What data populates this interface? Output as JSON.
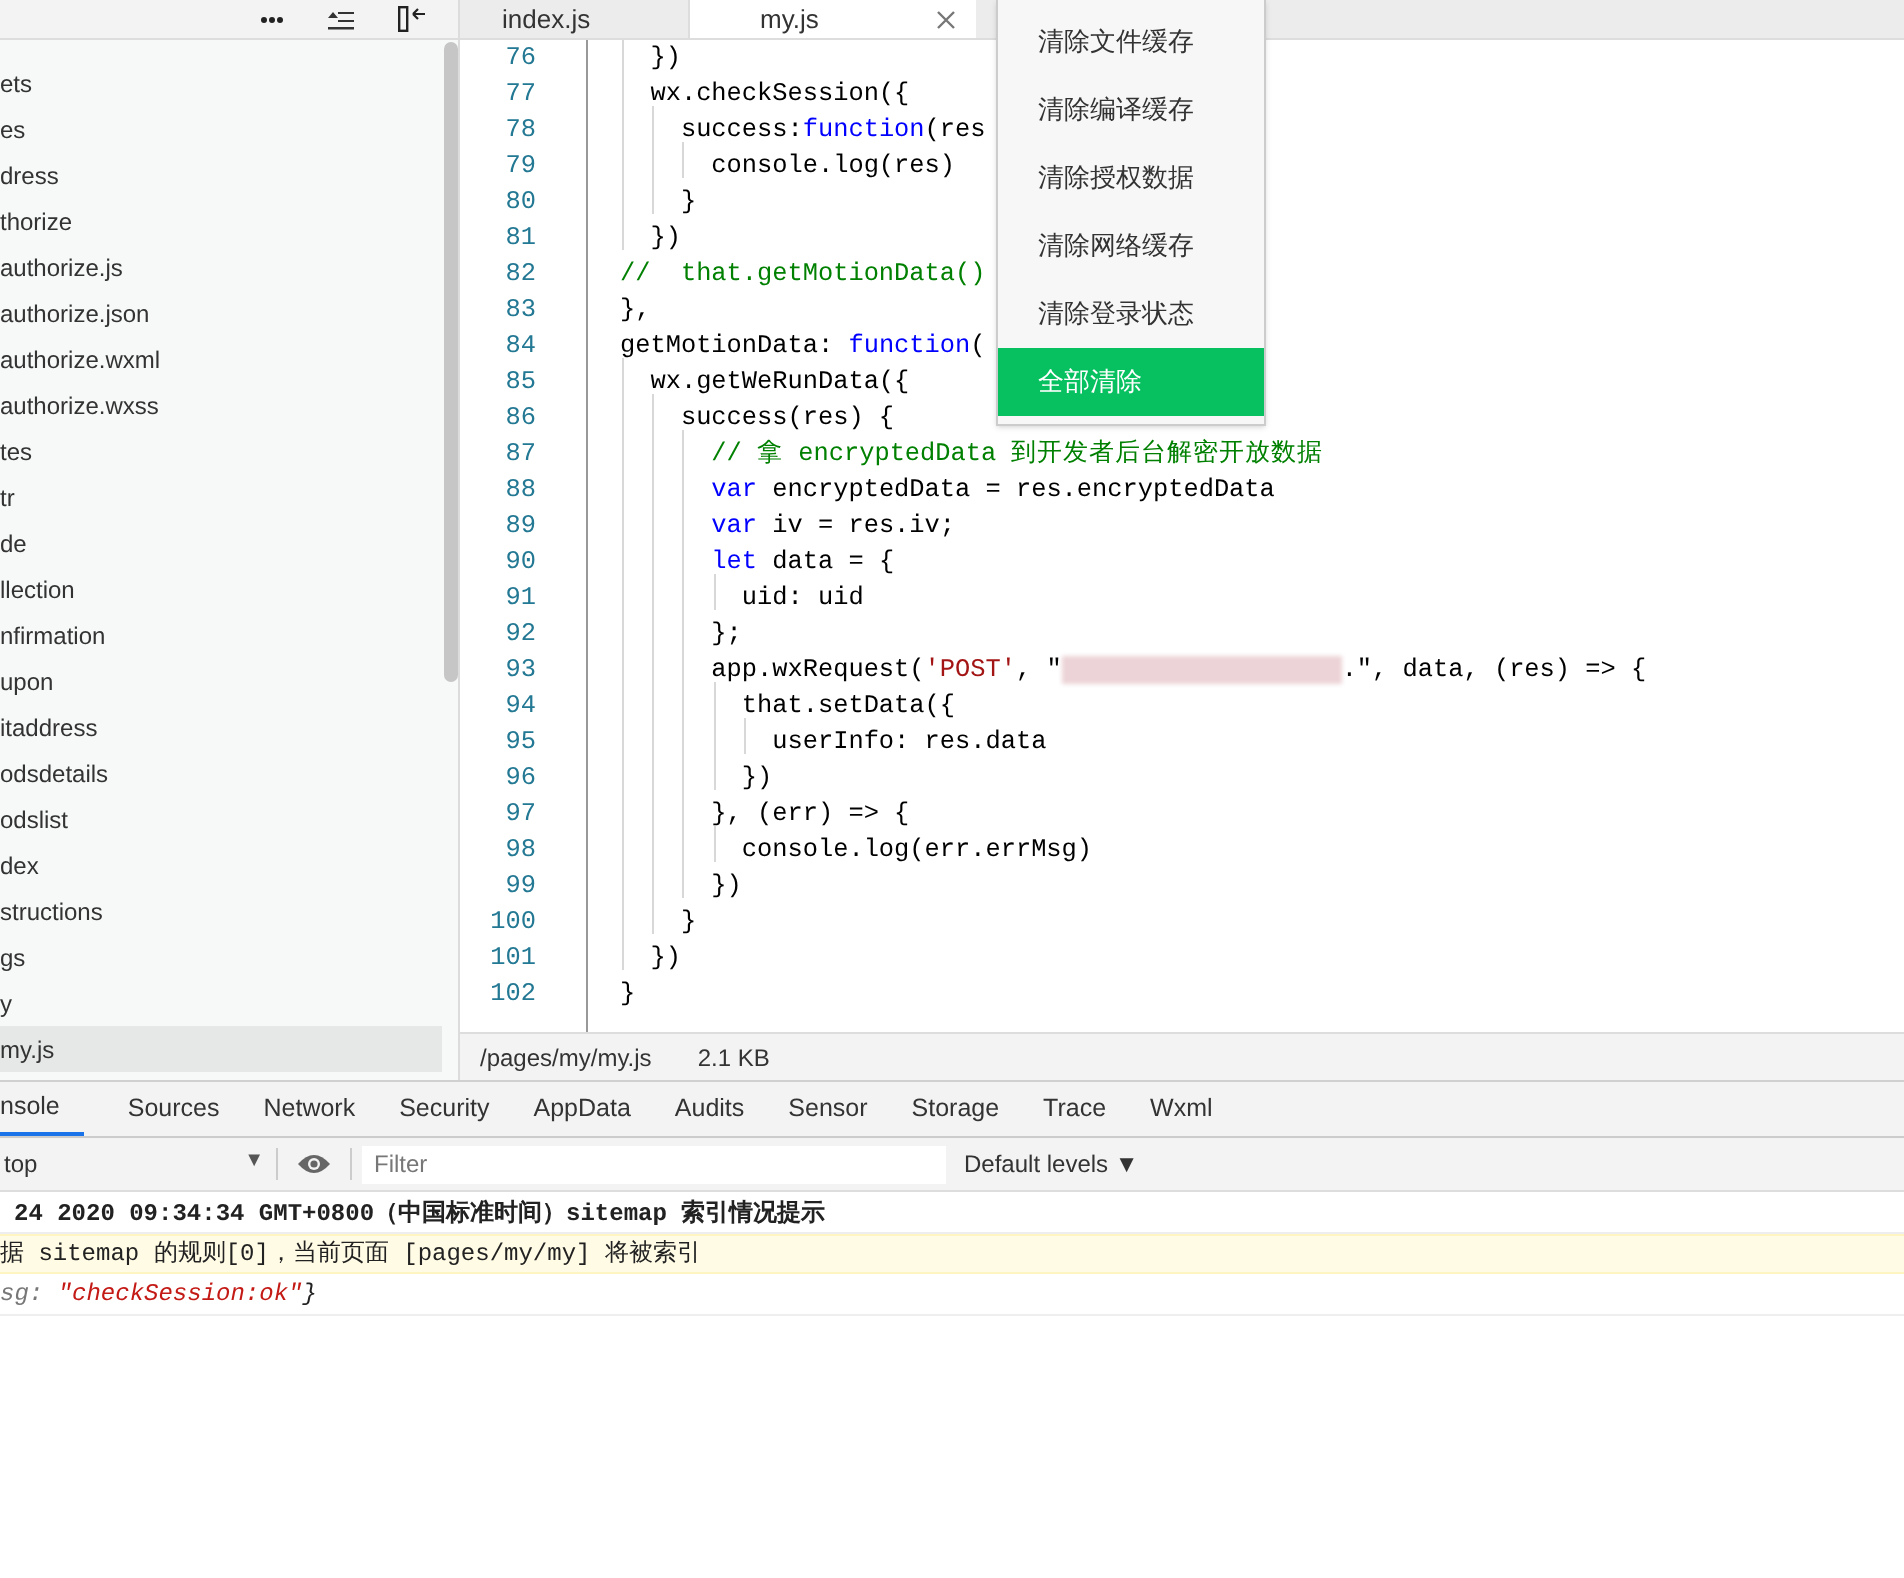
{
  "sidebar": {
    "items": [
      {
        "label": "ets",
        "selected": false
      },
      {
        "label": "es",
        "selected": false
      },
      {
        "label": "dress",
        "selected": false
      },
      {
        "label": "thorize",
        "selected": false
      },
      {
        "label": "authorize.js",
        "selected": false
      },
      {
        "label": "authorize.json",
        "selected": false
      },
      {
        "label": "authorize.wxml",
        "selected": false
      },
      {
        "label": "authorize.wxss",
        "selected": false
      },
      {
        "label": "tes",
        "selected": false
      },
      {
        "label": "tr",
        "selected": false
      },
      {
        "label": "de",
        "selected": false
      },
      {
        "label": "llection",
        "selected": false
      },
      {
        "label": "nfirmation",
        "selected": false
      },
      {
        "label": "upon",
        "selected": false
      },
      {
        "label": "itaddress",
        "selected": false
      },
      {
        "label": "odsdetails",
        "selected": false
      },
      {
        "label": "odslist",
        "selected": false
      },
      {
        "label": "dex",
        "selected": false
      },
      {
        "label": "structions",
        "selected": false
      },
      {
        "label": "gs",
        "selected": false
      },
      {
        "label": "y",
        "selected": false
      },
      {
        "label": "my.js",
        "selected": true
      }
    ]
  },
  "editor": {
    "tabs": [
      {
        "label": "index.js",
        "selected": false
      },
      {
        "label": "my.js",
        "selected": true
      }
    ],
    "lines": [
      {
        "number": "76",
        "segments": [
          {
            "kind": "plain",
            "text": "  })"
          }
        ]
      },
      {
        "number": "77",
        "segments": [
          {
            "kind": "plain",
            "text": "  wx.checkSession({"
          }
        ]
      },
      {
        "number": "78",
        "segments": [
          {
            "kind": "plain",
            "text": "    success:"
          },
          {
            "kind": "keyword",
            "text": "function"
          },
          {
            "kind": "plain",
            "text": "(res"
          }
        ]
      },
      {
        "number": "79",
        "segments": [
          {
            "kind": "plain",
            "text": "      console.log(res)"
          }
        ]
      },
      {
        "number": "80",
        "segments": [
          {
            "kind": "plain",
            "text": "    }"
          }
        ]
      },
      {
        "number": "81",
        "segments": [
          {
            "kind": "plain",
            "text": "  })"
          }
        ]
      },
      {
        "number": "82",
        "segments": [
          {
            "kind": "comment",
            "text": "//  that.getMotionData()"
          }
        ]
      },
      {
        "number": "83",
        "segments": [
          {
            "kind": "plain",
            "text": "},"
          }
        ]
      },
      {
        "number": "84",
        "segments": [
          {
            "kind": "plain",
            "text": "getMotionData: "
          },
          {
            "kind": "keyword",
            "text": "function"
          },
          {
            "kind": "plain",
            "text": "("
          }
        ]
      },
      {
        "number": "85",
        "segments": [
          {
            "kind": "plain",
            "text": "  wx.getWeRunData({"
          }
        ]
      },
      {
        "number": "86",
        "segments": [
          {
            "kind": "plain",
            "text": "    success(res) {"
          }
        ]
      },
      {
        "number": "87",
        "segments": [
          {
            "kind": "comment",
            "text": "      // 拿 encryptedData 到开发者后台解密开放数据"
          }
        ]
      },
      {
        "number": "88",
        "segments": [
          {
            "kind": "keyword",
            "text": "      var"
          },
          {
            "kind": "plain",
            "text": " encryptedData = res.encryptedData"
          }
        ]
      },
      {
        "number": "89",
        "segments": [
          {
            "kind": "keyword",
            "text": "      var"
          },
          {
            "kind": "plain",
            "text": " iv = res.iv;"
          }
        ]
      },
      {
        "number": "90",
        "segments": [
          {
            "kind": "keyword",
            "text": "      let"
          },
          {
            "kind": "plain",
            "text": " data = {"
          }
        ]
      },
      {
        "number": "91",
        "segments": [
          {
            "kind": "plain",
            "text": "        uid: uid"
          }
        ]
      },
      {
        "number": "92",
        "segments": [
          {
            "kind": "plain",
            "text": "      };"
          }
        ]
      },
      {
        "number": "93",
        "segments": [
          {
            "kind": "plain",
            "text": "      app.wxRequest("
          },
          {
            "kind": "string",
            "text": "'POST'"
          },
          {
            "kind": "plain",
            "text": ", \""
          },
          {
            "kind": "redacted"
          },
          {
            "kind": "plain",
            "text": ".\", data, (res) => {"
          }
        ]
      },
      {
        "number": "94",
        "segments": [
          {
            "kind": "plain",
            "text": "        that.setData({"
          }
        ]
      },
      {
        "number": "95",
        "segments": [
          {
            "kind": "plain",
            "text": "          userInfo: res.data"
          }
        ]
      },
      {
        "number": "96",
        "segments": [
          {
            "kind": "plain",
            "text": "        })"
          }
        ]
      },
      {
        "number": "97",
        "segments": [
          {
            "kind": "plain",
            "text": "      }, (err) => {"
          }
        ]
      },
      {
        "number": "98",
        "segments": [
          {
            "kind": "plain",
            "text": "        console.log(err.errMsg)"
          }
        ]
      },
      {
        "number": "99",
        "segments": [
          {
            "kind": "plain",
            "text": "      })"
          }
        ]
      },
      {
        "number": "100",
        "segments": [
          {
            "kind": "plain",
            "text": "    }"
          }
        ]
      },
      {
        "number": "101",
        "segments": [
          {
            "kind": "plain",
            "text": "  })"
          }
        ]
      },
      {
        "number": "102",
        "segments": [
          {
            "kind": "plain",
            "text": "}"
          }
        ]
      }
    ],
    "status": {
      "path": "/pages/my/my.js",
      "size": "2.1 KB"
    }
  },
  "menu": {
    "items": [
      {
        "label": "清除文件缓存",
        "highlighted": false
      },
      {
        "label": "清除编译缓存",
        "highlighted": false
      },
      {
        "label": "清除授权数据",
        "highlighted": false
      },
      {
        "label": "清除网络缓存",
        "highlighted": false
      },
      {
        "label": "清除登录状态",
        "highlighted": false
      },
      {
        "label": "全部清除",
        "highlighted": true
      }
    ]
  },
  "devtools": {
    "tabs": [
      {
        "label": "nsole",
        "selected": true
      },
      {
        "label": "Sources",
        "selected": false
      },
      {
        "label": "Network",
        "selected": false
      },
      {
        "label": "Security",
        "selected": false
      },
      {
        "label": "AppData",
        "selected": false
      },
      {
        "label": "Audits",
        "selected": false
      },
      {
        "label": "Sensor",
        "selected": false
      },
      {
        "label": "Storage",
        "selected": false
      },
      {
        "label": "Trace",
        "selected": false
      },
      {
        "label": "Wxml",
        "selected": false
      }
    ],
    "context": "top",
    "filter": {
      "placeholder": "Filter"
    },
    "levels": "Default levels ▼",
    "context_caret": "▼",
    "messages": [
      {
        "kind": "info",
        "segments": [
          {
            "kind": "plain",
            "text": "24 2020 09:34:34 GMT+0800（中国标准时间）sitemap 索引情况提示"
          }
        ]
      },
      {
        "kind": "warning",
        "segments": [
          {
            "kind": "plain",
            "text": "据 sitemap 的规则[0]，当前页面 [pages/my/my] 将被索引"
          }
        ]
      },
      {
        "kind": "log",
        "segments": [
          {
            "kind": "key",
            "text": "sg: "
          },
          {
            "kind": "string",
            "text": "\"checkSession:ok\""
          },
          {
            "kind": "plain",
            "text": "}"
          }
        ]
      }
    ]
  }
}
